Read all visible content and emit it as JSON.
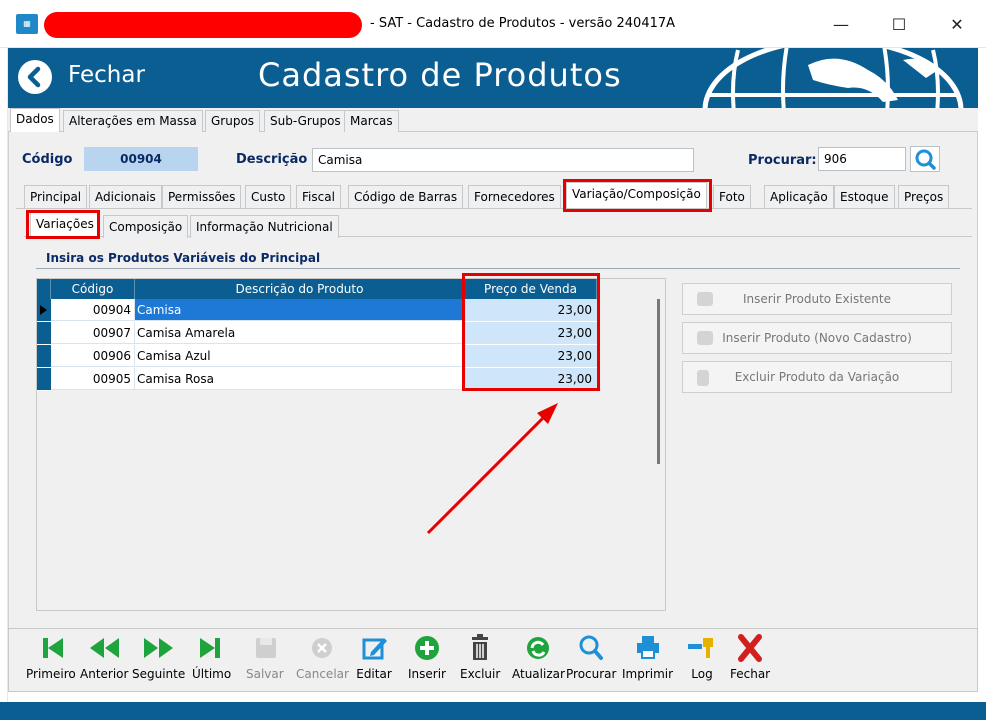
{
  "window": {
    "title": "- SAT - Cadastro de Produtos - versão 240417A",
    "minimize": "—",
    "maximize": "☐",
    "close": "✕"
  },
  "banner": {
    "back_label": "Fechar",
    "title": "Cadastro de Produtos"
  },
  "top_tabs": [
    "Dados",
    "Alterações em Massa",
    "Grupos",
    "Sub-Grupos",
    "Marcas"
  ],
  "form": {
    "codigo_label": "Código",
    "codigo_value": "00904",
    "descricao_label": "Descrição",
    "descricao_value": "Camisa",
    "procurar_label": "Procurar:",
    "procurar_value": "906"
  },
  "section_tabs": [
    "Principal",
    "Adicionais",
    "Permissões",
    "Custo",
    "Fiscal",
    "Código de Barras",
    "Fornecedores",
    "Variação/Composição",
    "Foto",
    "Aplicação",
    "Estoque",
    "Preços"
  ],
  "sub_tabs": [
    "Variações",
    "Composição",
    "Informação Nutricional"
  ],
  "section_title": "Insira os Produtos Variáveis do Principal",
  "grid": {
    "headers": [
      "Código",
      "Descrição do Produto",
      "Preço de Venda"
    ],
    "rows": [
      {
        "codigo": "00904",
        "descricao": "Camisa",
        "preco": "23,00"
      },
      {
        "codigo": "00907",
        "descricao": "Camisa Amarela",
        "preco": "23,00"
      },
      {
        "codigo": "00906",
        "descricao": "Camisa Azul",
        "preco": "23,00"
      },
      {
        "codigo": "00905",
        "descricao": "Camisa Rosa",
        "preco": "23,00"
      }
    ]
  },
  "right_buttons": [
    "Inserir Produto Existente",
    "Inserir Produto (Novo Cadastro)",
    "Excluir Produto da Variação"
  ],
  "toolbar": [
    "Primeiro",
    "Anterior",
    "Seguinte",
    "Último",
    "Salvar",
    "Cancelar",
    "Editar",
    "Inserir",
    "Excluir",
    "Atualizar",
    "Procurar",
    "Imprimir",
    "Log",
    "Fechar"
  ],
  "colors": {
    "brand_blue": "#0b5e91",
    "highlight_red": "#e60000",
    "nav_green": "#1fa33c"
  }
}
